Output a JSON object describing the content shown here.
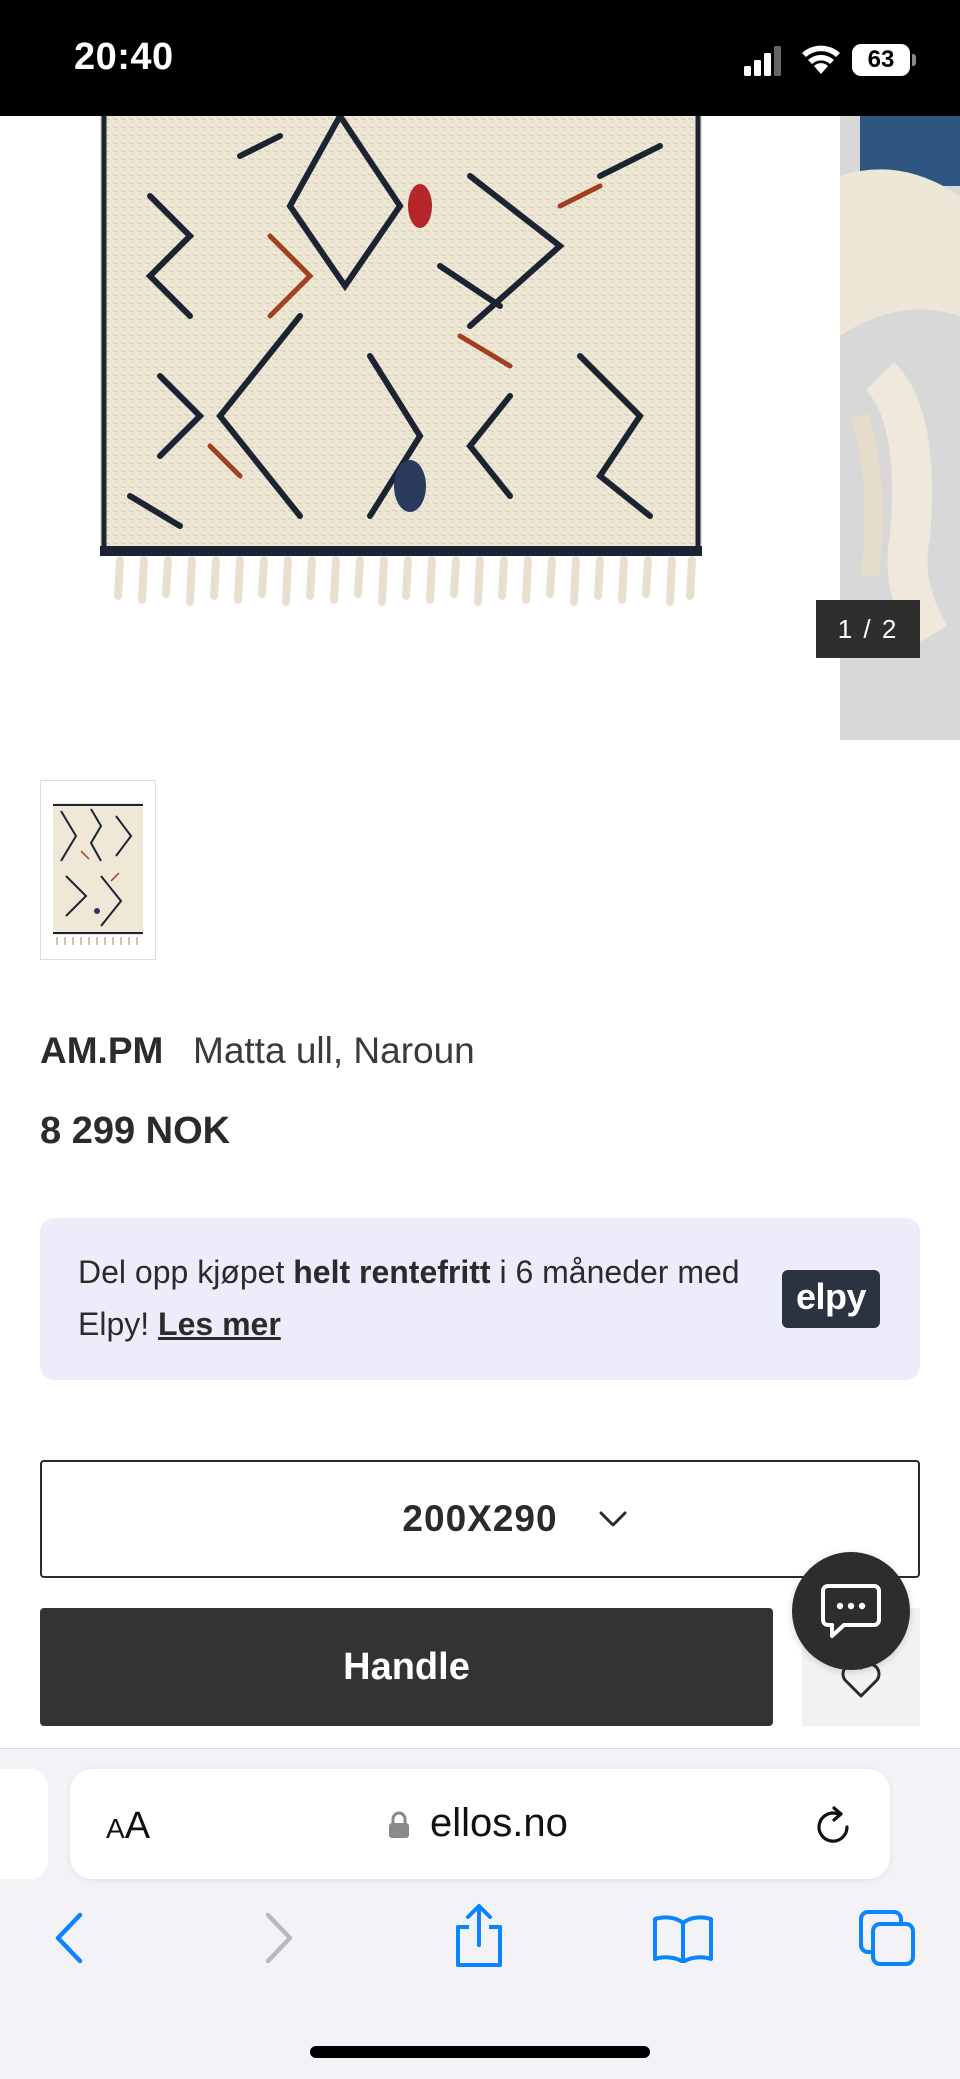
{
  "status_bar": {
    "time": "20:40",
    "battery": "63"
  },
  "gallery": {
    "counter": "1 / 2"
  },
  "product": {
    "brand": "AM.PM",
    "name": "Matta ull, Naroun",
    "price": "8 299 NOK"
  },
  "elpy": {
    "text_prefix": "Del opp kjøpet ",
    "text_bold": "helt rentefritt",
    "text_middle": " i 6 måneder med Elpy! ",
    "link": "Les mer",
    "logo": "elpy",
    "background": "#ececfb"
  },
  "size_select": {
    "value": "200X290"
  },
  "actions": {
    "buy_label": "Handle",
    "buy_color": "#333333"
  },
  "browser": {
    "aa_small": "A",
    "aa_large": "A",
    "url": "ellos.no"
  },
  "icons": {
    "status": [
      "signal-icon",
      "wifi-icon",
      "battery-icon"
    ],
    "toolbar": [
      "back-icon",
      "forward-icon",
      "share-icon",
      "bookmarks-icon",
      "tabs-icon"
    ],
    "product": [
      "chevron-down-icon",
      "heart-icon",
      "chat-icon",
      "lock-icon",
      "reload-icon"
    ]
  },
  "colors": {
    "ios_blue": "#0a84ff",
    "rug_cream": "#efe8d6",
    "rug_navy": "#1c2433",
    "rug_rust": "#a0401f"
  }
}
